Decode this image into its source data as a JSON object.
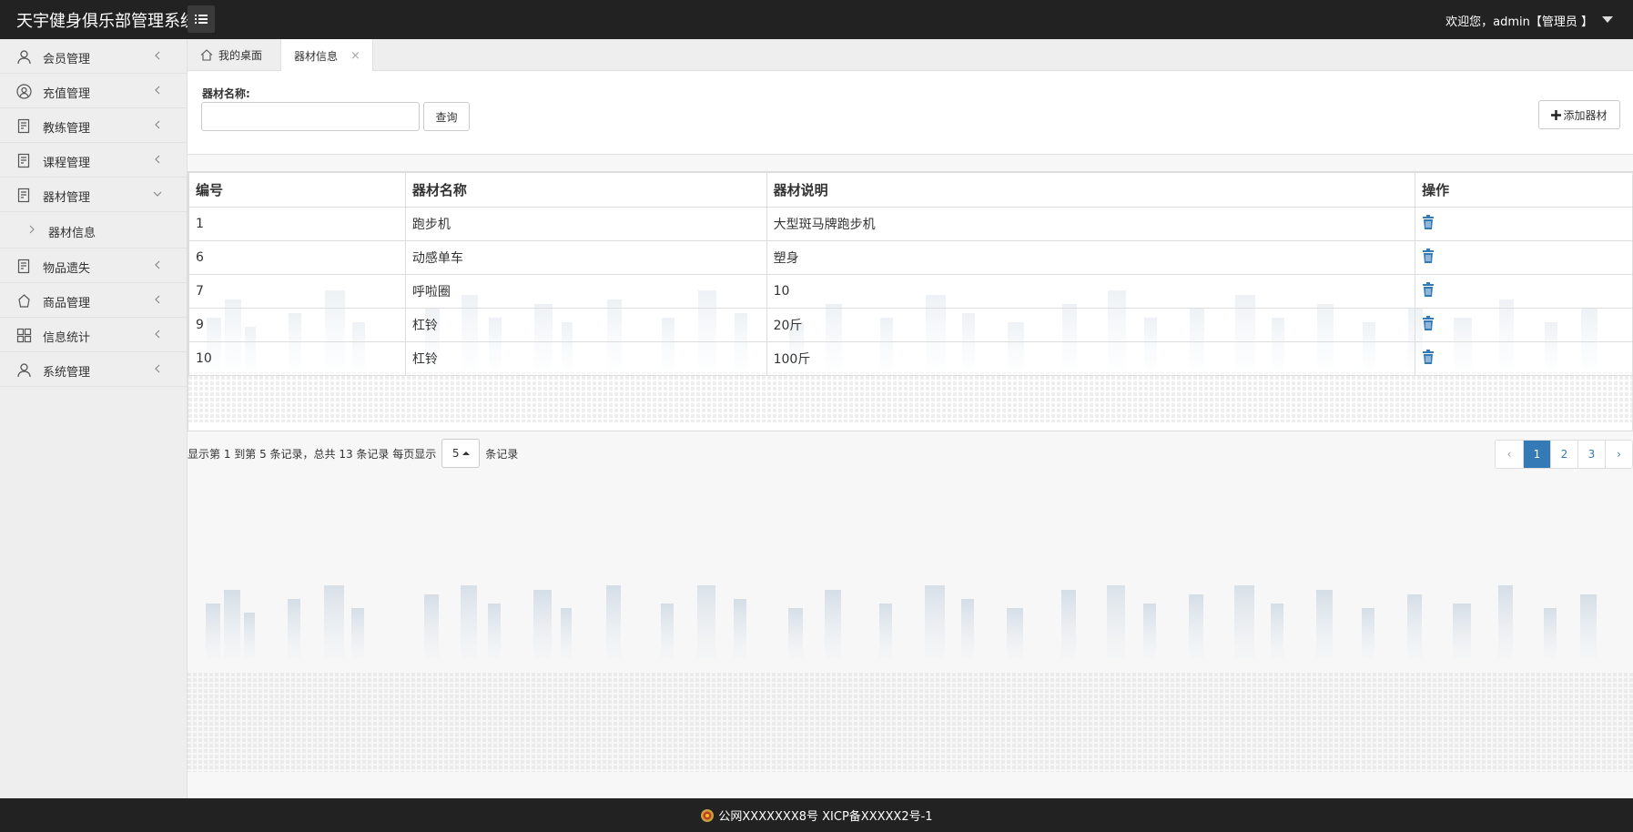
{
  "header": {
    "title": "天宇健身俱乐部管理系统",
    "user_text": "欢迎您，admin【管理员 】"
  },
  "sidebar": {
    "items": [
      {
        "label": "会员管理",
        "icon": "user-icon"
      },
      {
        "label": "充值管理",
        "icon": "user-circle-icon"
      },
      {
        "label": "教练管理",
        "icon": "doc-icon"
      },
      {
        "label": "课程管理",
        "icon": "doc-icon"
      },
      {
        "label": "器材管理",
        "icon": "doc-icon",
        "expanded": true
      },
      {
        "label": "物品遗失",
        "icon": "doc-icon"
      },
      {
        "label": "商品管理",
        "icon": "bag-icon"
      },
      {
        "label": "信息统计",
        "icon": "grid-icon"
      },
      {
        "label": "系统管理",
        "icon": "user-icon"
      }
    ],
    "sub_item": "器材信息"
  },
  "tabs": {
    "home": "我的桌面",
    "active": "器材信息"
  },
  "search": {
    "label": "器材名称:",
    "value": "",
    "query_button": "查询",
    "add_button": "添加器材"
  },
  "table": {
    "headers": [
      "编号",
      "器材名称",
      "器材说明",
      "操作"
    ],
    "rows": [
      [
        "1",
        "跑步机",
        "大型斑马牌跑步机"
      ],
      [
        "6",
        "动感单车",
        "塑身"
      ],
      [
        "7",
        "呼啦圈",
        "10"
      ],
      [
        "9",
        "杠铃",
        "20斤"
      ],
      [
        "10",
        "杠铃",
        "100斤"
      ]
    ]
  },
  "pager": {
    "info_left": "显示第 1 到第 5 条记录，总共 13 条记录 每页显示",
    "page_size": "5",
    "info_right": "条记录",
    "prev": "‹",
    "pages": [
      "1",
      "2",
      "3"
    ],
    "next": "›",
    "current": "1"
  },
  "footer": {
    "text": "公网XXXXXXX8号 XICP备XXXXX2号-1"
  },
  "colors": {
    "topbar": "#222222",
    "accent": "#337ab7",
    "sidebar": "#eeeeee"
  }
}
